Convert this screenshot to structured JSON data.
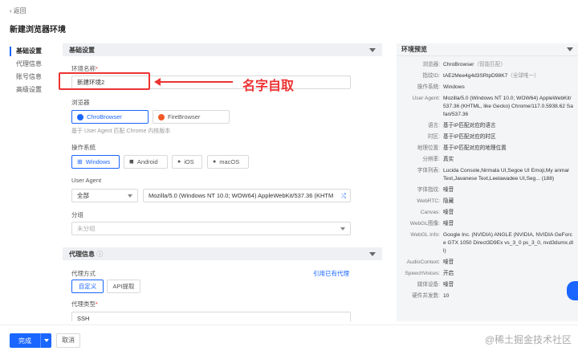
{
  "header": {
    "back_label": "返回",
    "title": "新建浏览器环境"
  },
  "sidenav": [
    "基础设置",
    "代理信息",
    "账号信息",
    "高级设置"
  ],
  "basic": {
    "section_title": "基础设置",
    "env_name_label": "环境名称",
    "env_name_value": "新建环境2",
    "browser_label": "浏览器",
    "browser_opt1": "ChroBrowser",
    "browser_opt2": "FireBrowser",
    "browser_hint": "基于 User Agent 匹配 Chrome 内核版本",
    "os_label": "操作系统",
    "os_opts": [
      "Windows",
      "Android",
      "iOS",
      "macOS"
    ],
    "ua_label": "User Agent",
    "ua_scope": "全部",
    "ua_value": "Mozilla/5.0 (Windows NT 10.0; WOW64) AppleWebKit/537.36 (KHTM",
    "group_label": "分组",
    "group_placeholder": "未分组"
  },
  "proxy": {
    "section_title": "代理信息",
    "mode_label": "代理方式",
    "mode_opt1": "自定义",
    "mode_opt2": "API提取",
    "use_existing": "引用已有代理",
    "type_label": "代理类型",
    "type_value": "SSH"
  },
  "annotation": "名字自取",
  "preview": {
    "title": "环境预览",
    "rows": [
      {
        "k": "浏览器:",
        "v": "ChroBrowser",
        "g": "（智能匹配）"
      },
      {
        "k": "指纹ID:",
        "v": "tAE2Mee4g4d3SRtpD98K7",
        "g": "（全球唯一）"
      },
      {
        "k": "操作系统:",
        "v": "Windows",
        "g": ""
      },
      {
        "k": "User Agent:",
        "v": "Mozilla/5.0 (Windows NT 10.0; WOW64) AppleWebKit/537.36 (KHTML, like Gecko) Chrome/117.0.5938.62 Safari/537.36",
        "g": ""
      },
      {
        "k": "语言:",
        "v": "基于IP匹配对应的语言",
        "g": ""
      },
      {
        "k": "时区:",
        "v": "基于IP匹配对应的时区",
        "g": ""
      },
      {
        "k": "地理位置:",
        "v": "基于IP匹配对应的地理位置",
        "g": ""
      },
      {
        "k": "分辨率:",
        "v": "真实",
        "g": ""
      },
      {
        "k": "字体列表:",
        "v": "Lucida Console,Nirmala UI,Segoe UI Emoji,My anmar Text,Javanese Text,Leelawadee UI,Seg... (188)",
        "g": ""
      },
      {
        "k": "字体指纹:",
        "v": "噪音",
        "g": ""
      },
      {
        "k": "WebRTC:",
        "v": "隐藏",
        "g": ""
      },
      {
        "k": "Canvas:",
        "v": "噪音",
        "g": ""
      },
      {
        "k": "WebGL图像:",
        "v": "噪音",
        "g": ""
      },
      {
        "k": "WebGL Info:",
        "v": "Google Inc. (NVIDIA) ANGLE (NVIDIA, NVIDIA GeForce GTX 1050 Direct3D9Ex vs_3_0 ps_3_0, nvd3dumx.dll)",
        "g": ""
      },
      {
        "k": "AudioContext:",
        "v": "噪音",
        "g": ""
      },
      {
        "k": "SpeechVoices:",
        "v": "开启",
        "g": ""
      },
      {
        "k": "媒体设备:",
        "v": "噪音",
        "g": ""
      },
      {
        "k": "硬件并发数:",
        "v": "10",
        "g": ""
      }
    ]
  },
  "footer": {
    "done": "完成",
    "cancel": "取消"
  },
  "watermark": "@稀土掘金技术社区"
}
